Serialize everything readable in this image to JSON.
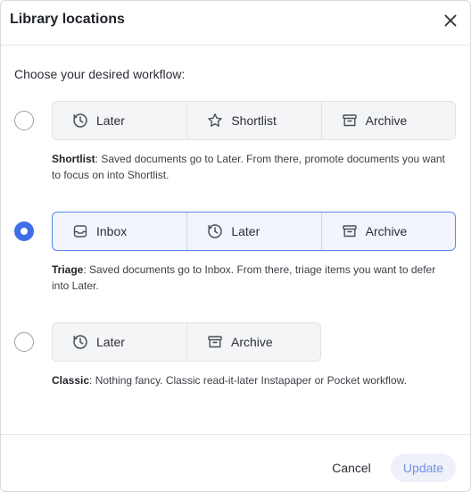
{
  "dialog": {
    "title": "Library locations",
    "prompt": "Choose your desired workflow:"
  },
  "options": [
    {
      "name": "Shortlist",
      "selected": false,
      "locations": [
        {
          "label": "Later",
          "icon": "clock-icon"
        },
        {
          "label": "Shortlist",
          "icon": "star-icon"
        },
        {
          "label": "Archive",
          "icon": "archive-icon"
        }
      ],
      "description_term": "Shortlist",
      "description_text": ": Saved documents go to Later. From there, promote documents you want to focus on into Shortlist."
    },
    {
      "name": "Triage",
      "selected": true,
      "locations": [
        {
          "label": "Inbox",
          "icon": "inbox-icon"
        },
        {
          "label": "Later",
          "icon": "clock-icon"
        },
        {
          "label": "Archive",
          "icon": "archive-icon"
        }
      ],
      "description_term": "Triage",
      "description_text": ": Saved documents go to Inbox. From there, triage items you want to defer into Later."
    },
    {
      "name": "Classic",
      "selected": false,
      "locations": [
        {
          "label": "Later",
          "icon": "clock-icon"
        },
        {
          "label": "Archive",
          "icon": "archive-icon"
        }
      ],
      "description_term": "Classic",
      "description_text": ": Nothing fancy. Classic read-it-later Instapaper or Pocket workflow."
    }
  ],
  "footer": {
    "cancel_label": "Cancel",
    "update_label": "Update"
  },
  "colors": {
    "accent": "#3f6ee8",
    "update_text": "#6f91e6",
    "update_bg": "#eef1f8"
  }
}
